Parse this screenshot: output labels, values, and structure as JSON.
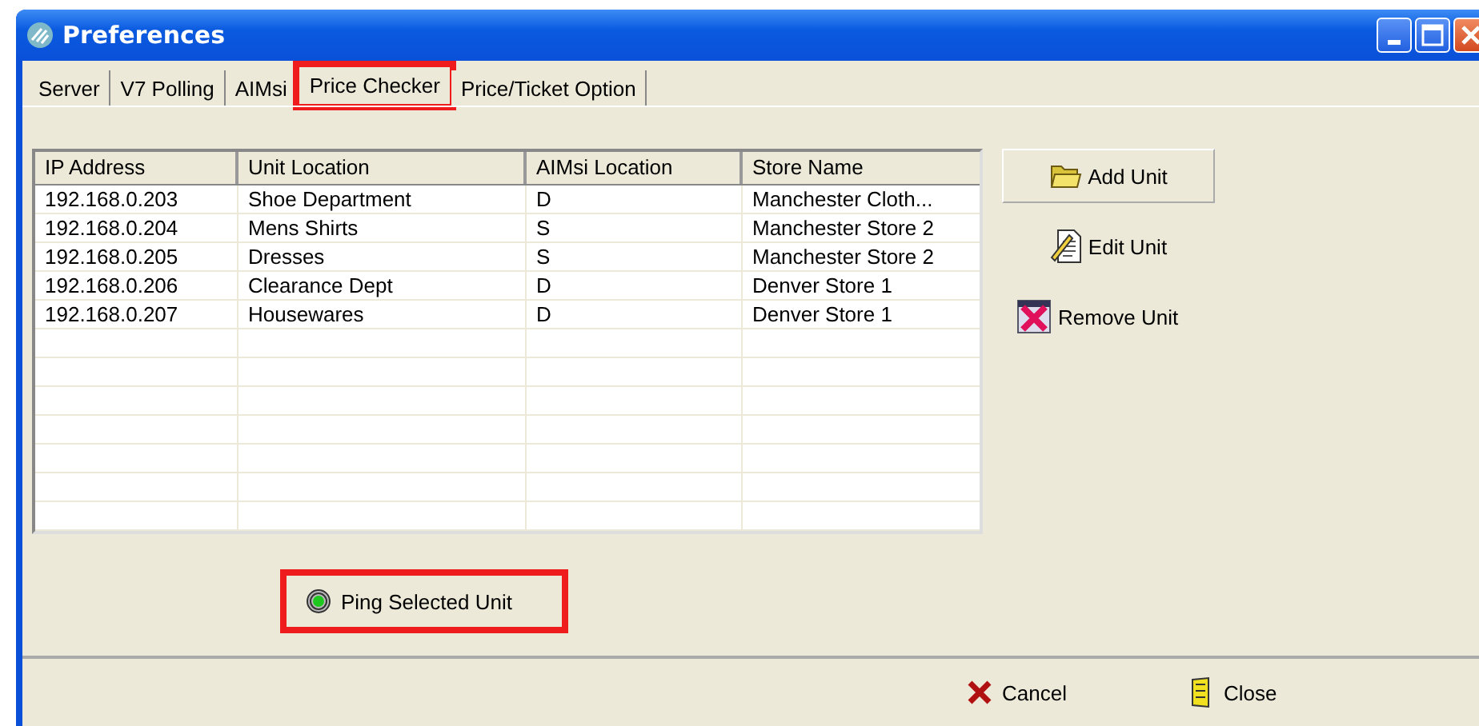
{
  "window": {
    "title": "Preferences"
  },
  "tabs": [
    {
      "label": "Server",
      "selected": false,
      "highlighted": false
    },
    {
      "label": "V7 Polling",
      "selected": false,
      "highlighted": false
    },
    {
      "label": "AIMsi",
      "selected": false,
      "highlighted": false
    },
    {
      "label": "Price Checker",
      "selected": true,
      "highlighted": true
    },
    {
      "label": "Price/Ticket Option",
      "selected": false,
      "highlighted": false
    }
  ],
  "table": {
    "columns": [
      "IP Address",
      "Unit Location",
      "AIMsi Location",
      "Store Name"
    ],
    "rows": [
      [
        "192.168.0.203",
        "Shoe Department",
        "D",
        "Manchester Cloth..."
      ],
      [
        "192.168.0.204",
        "Mens Shirts",
        "S",
        "Manchester Store 2"
      ],
      [
        "192.168.0.205",
        "Dresses",
        "S",
        "Manchester Store 2"
      ],
      [
        "192.168.0.206",
        "Clearance Dept",
        "D",
        "Denver Store 1"
      ],
      [
        "192.168.0.207",
        "Housewares",
        "D",
        "Denver Store 1"
      ]
    ]
  },
  "side_buttons": [
    {
      "label": "Add Unit",
      "kind": "add"
    },
    {
      "label": "Edit Unit",
      "kind": "edit"
    },
    {
      "label": "Remove Unit",
      "kind": "remove"
    }
  ],
  "ping_button": {
    "label": "Ping Selected Unit",
    "highlighted": true
  },
  "footer_buttons": [
    {
      "label": "Cancel",
      "kind": "cancel"
    },
    {
      "label": "Close",
      "kind": "close"
    }
  ]
}
